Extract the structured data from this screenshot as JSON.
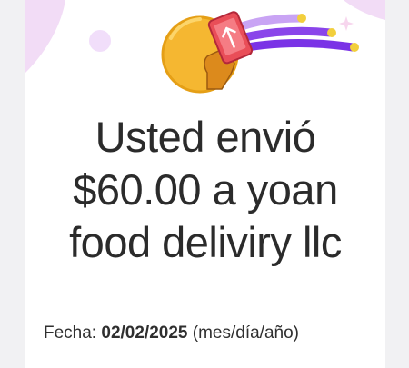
{
  "colors": {
    "brand_purple": "#7a33e6",
    "coin_gold": "#f5b731",
    "phone_red": "#e94e58",
    "decor_pink": "#f1defa",
    "text_dark": "#2b2b2b"
  },
  "hero": {
    "illustration_icon": "coin-hand-phone-icon",
    "sparkle_icon": "sparkle-icon"
  },
  "headline": {
    "line1": "Usted envió",
    "line2": "$60.00 a yoan",
    "line3": "food deliviry llc"
  },
  "date_row": {
    "label": "Fecha:",
    "value": "02/02/2025",
    "format_hint": "(mes/día/año)"
  }
}
